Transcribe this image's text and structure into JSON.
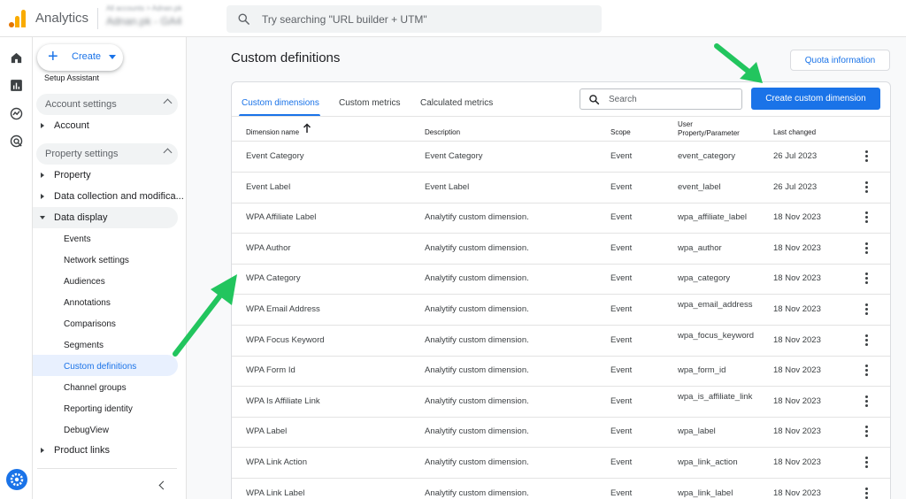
{
  "app": {
    "title": "Analytics",
    "account_sub": "All accounts > Adnan.pk",
    "account_name": "Adnan.pk - GA4"
  },
  "search": {
    "placeholder": "Try searching \"URL builder + UTM\""
  },
  "sidebar": {
    "create_label": "Create",
    "setup_assistant": "Setup Assistant",
    "account_settings": "Account settings",
    "account": "Account",
    "property_settings": "Property settings",
    "property": "Property",
    "data_collection": "Data collection and modifica...",
    "data_display": "Data display",
    "sub_items": [
      "Events",
      "Network settings",
      "Audiences",
      "Annotations",
      "Comparisons",
      "Segments",
      "Custom definitions",
      "Channel groups",
      "Reporting identity",
      "DebugView"
    ],
    "product_links": "Product links",
    "active_item": "Custom definitions"
  },
  "main": {
    "title": "Custom definitions",
    "quota_button": "Quota information",
    "tabs": [
      "Custom dimensions",
      "Custom metrics",
      "Calculated metrics"
    ],
    "active_tab": "Custom dimensions",
    "table_search_placeholder": "Search",
    "create_button": "Create custom dimension",
    "columns": [
      "Dimension name",
      "Description",
      "Scope",
      "User Property/Parameter",
      "Last changed"
    ],
    "sort": "ascending",
    "rows": [
      {
        "name": "Event Category",
        "description": "Event Category",
        "scope": "Event",
        "param": "event_category",
        "changed": "26 Jul 2023"
      },
      {
        "name": "Event Label",
        "description": "Event Label",
        "scope": "Event",
        "param": "event_label",
        "changed": "26 Jul 2023"
      },
      {
        "name": "WPA Affiliate Label",
        "description": "Analytify custom dimension.",
        "scope": "Event",
        "param": "wpa_affiliate_label",
        "changed": "18 Nov 2023"
      },
      {
        "name": "WPA Author",
        "description": "Analytify custom dimension.",
        "scope": "Event",
        "param": "wpa_author",
        "changed": "18 Nov 2023"
      },
      {
        "name": "WPA Category",
        "description": "Analytify custom dimension.",
        "scope": "Event",
        "param": "wpa_category",
        "changed": "18 Nov 2023"
      },
      {
        "name": "WPA Email Address",
        "description": "Analytify custom dimension.",
        "scope": "Event",
        "param": "wpa_email_address",
        "changed": "18 Nov 2023"
      },
      {
        "name": "WPA Focus Keyword",
        "description": "Analytify custom dimension.",
        "scope": "Event",
        "param": "wpa_focus_keyword",
        "changed": "18 Nov 2023"
      },
      {
        "name": "WPA Form Id",
        "description": "Analytify custom dimension.",
        "scope": "Event",
        "param": "wpa_form_id",
        "changed": "18 Nov 2023"
      },
      {
        "name": "WPA Is Affiliate Link",
        "description": "Analytify custom dimension.",
        "scope": "Event",
        "param": "wpa_is_affiliate_link",
        "changed": "18 Nov 2023"
      },
      {
        "name": "WPA Label",
        "description": "Analytify custom dimension.",
        "scope": "Event",
        "param": "wpa_label",
        "changed": "18 Nov 2023"
      },
      {
        "name": "WPA Link Action",
        "description": "Analytify custom dimension.",
        "scope": "Event",
        "param": "wpa_link_action",
        "changed": "18 Nov 2023"
      },
      {
        "name": "WPA Link Label",
        "description": "Analytify custom dimension.",
        "scope": "Event",
        "param": "wpa_link_label",
        "changed": "18 Nov 2023"
      }
    ]
  },
  "colors": {
    "accent": "#1a73e8",
    "annotation_arrow": "#22c55e",
    "active_bg": "#e8f0fe"
  }
}
